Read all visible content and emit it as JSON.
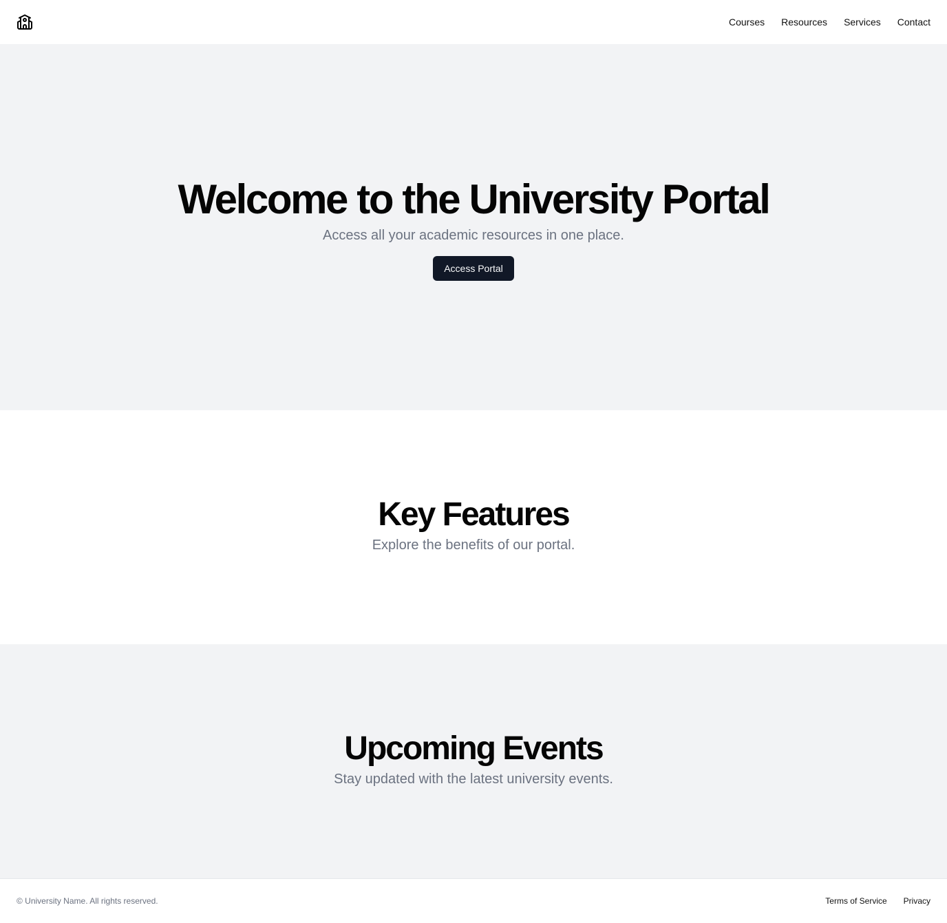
{
  "header": {
    "logo_icon": "school-building-icon",
    "nav": [
      {
        "label": "Courses"
      },
      {
        "label": "Resources"
      },
      {
        "label": "Services"
      },
      {
        "label": "Contact"
      }
    ]
  },
  "hero": {
    "title": "Welcome to the University Portal",
    "subtitle": "Access all your academic resources in one place.",
    "cta_label": "Access Portal"
  },
  "features": {
    "title": "Key Features",
    "subtitle": "Explore the benefits of our portal."
  },
  "events": {
    "title": "Upcoming Events",
    "subtitle": "Stay updated with the latest university events."
  },
  "footer": {
    "copyright": "© University Name. All rights reserved.",
    "links": [
      {
        "label": "Terms of Service"
      },
      {
        "label": "Privacy"
      }
    ]
  },
  "colors": {
    "section_gray": "#f2f3f5",
    "primary_button": "#111827",
    "muted_text": "#6b7280"
  }
}
